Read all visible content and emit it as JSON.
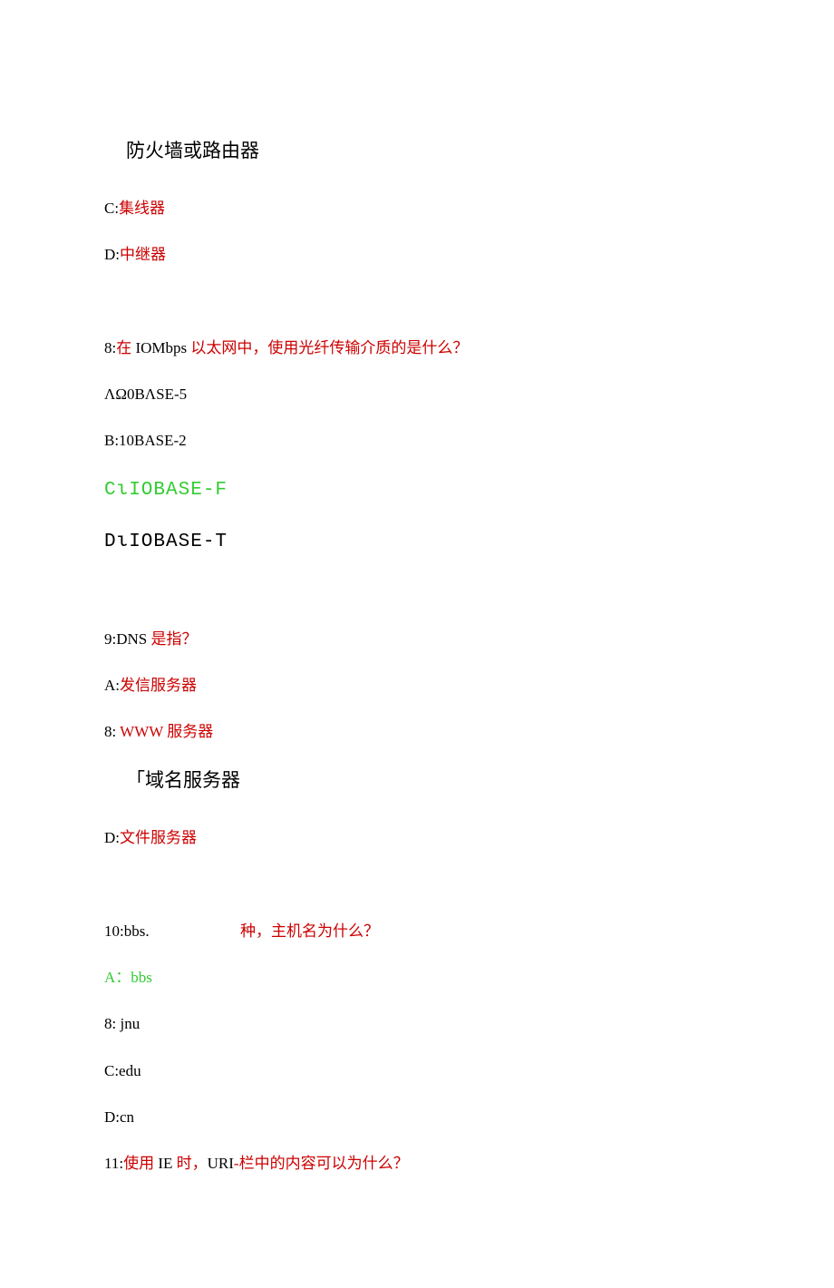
{
  "q7_answer_b": "防火墙或路由器",
  "q7_c_prefix": "C:",
  "q7_c_text": "集线器",
  "q7_d_prefix": "D:",
  "q7_d_text": "中继器",
  "q8_prefix": "8:",
  "q8_part1": "在",
  "q8_part_mid": " IOMbps ",
  "q8_part2": "以太网中，使用光纤传输介质的是什么？",
  "q8_a": "ΛΩ0BΛSE-5",
  "q8_b": "B:10BASE-2",
  "q8_c": "CιIOBASE-F",
  "q8_d": "DιIOBASE-T",
  "q9_prefix": "9:DNS",
  "q9_text": " 是指？",
  "q9_a_prefix": "A:",
  "q9_a_text": "发信服务器",
  "q9_b_prefix": "8:  ",
  "q9_b_text": "WWW 服务器",
  "q9_c": "「域名服务器",
  "q9_d_prefix": "D:",
  "q9_d_text": "文件服务器",
  "q10_prefix": "10:bbs.",
  "q10_text": "种，主机名为什么？",
  "q10_a": "A：bbs",
  "q10_b": "8:  jnu",
  "q10_c": "C:edu",
  "q10_d": "D:cn",
  "q11_prefix": "11:",
  "q11_part1": "使用",
  "q11_mid1": " IE ",
  "q11_part2": "时，",
  "q11_mid2": "URI",
  "q11_dash": "-",
  "q11_part3": "栏中的内容可以为什么？"
}
